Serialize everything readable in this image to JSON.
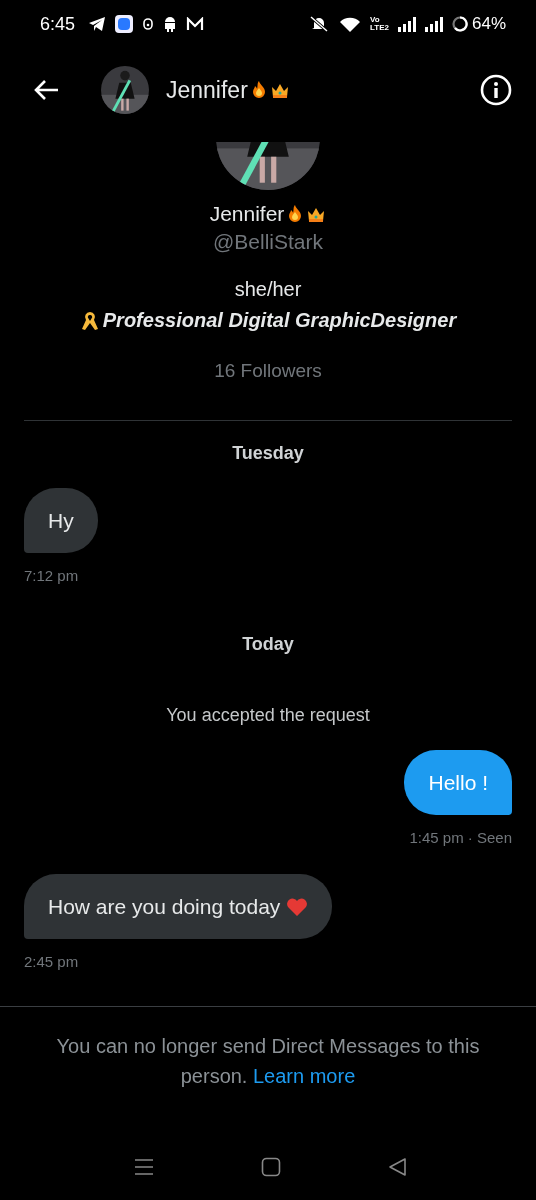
{
  "status_bar": {
    "time": "6:45",
    "network": "Vo",
    "network_sub": "LTE2",
    "battery": "64%"
  },
  "header": {
    "title": "Jennifer"
  },
  "profile": {
    "name": "Jennifer",
    "handle": "@BelliStark",
    "pronouns": "she/her",
    "bio": "Professional Digital GraphicDesigner",
    "followers": "16 Followers"
  },
  "messages": [
    {
      "kind": "day",
      "text": "Tuesday"
    },
    {
      "kind": "received",
      "text": "Hy",
      "time": "7:12 pm",
      "heart": false
    },
    {
      "kind": "day",
      "text": "Today"
    },
    {
      "kind": "notice",
      "text": "You accepted the request"
    },
    {
      "kind": "sent",
      "text": "Hello !",
      "time": "1:45 pm · Seen"
    },
    {
      "kind": "received",
      "text": "How are you doing today",
      "time": "2:45 pm",
      "heart": true
    }
  ],
  "footer": {
    "text": "You can no longer send Direct Messages to this person.",
    "link": "Learn more"
  }
}
